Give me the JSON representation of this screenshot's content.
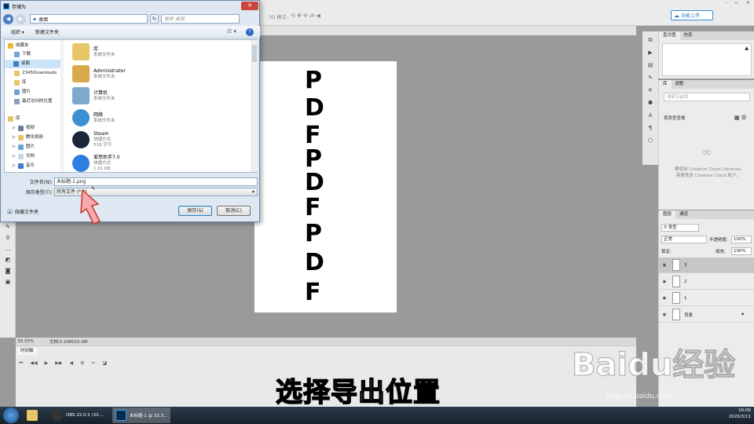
{
  "photoshop": {
    "options_3d_label": "3D 模式:",
    "upload_button": "功能上传",
    "status": {
      "zoom": "33.33%",
      "doc_size": "文档:5.93M/15.0M"
    },
    "timeline_tab": "时间轴",
    "document_letters": [
      "P",
      "D",
      "F",
      "P",
      "D",
      "F",
      "P",
      "D",
      "F"
    ],
    "panels": {
      "top_tabs": [
        "直方图",
        "信息"
      ],
      "library_tabs": [
        "库",
        "调整"
      ],
      "library_search_placeholder": "搜索当前库",
      "library_filter": "按类型查看",
      "library_message_line1": "要使用 Creative Cloud Libraries,",
      "library_message_line2": "需要登录 Creative Cloud 帐户。",
      "layers_tabs": [
        "图层",
        "通道"
      ],
      "layer_kind": "类型",
      "blend_mode": "正常",
      "opacity_label": "不透明度:",
      "opacity_value": "100%",
      "lock_label": "锁定:",
      "fill_label": "填充:",
      "fill_value": "100%",
      "layers": [
        {
          "name": "3",
          "selected": true
        },
        {
          "name": "2",
          "selected": false
        },
        {
          "name": "1",
          "selected": false
        },
        {
          "name": "背景",
          "selected": false
        }
      ]
    }
  },
  "dialog": {
    "title": "存储为",
    "address": "桌面",
    "search_placeholder": "搜索 桌面",
    "organize": "组织 ▾",
    "new_folder": "新建文件夹",
    "nav": [
      {
        "label": "收藏夹",
        "color": "#e8b93a"
      },
      {
        "label": "下载",
        "color": "#6fa3d6"
      },
      {
        "label": "桌面",
        "color": "#3b7dc8"
      },
      {
        "label": "2345Downloads",
        "color": "#e8c567"
      },
      {
        "label": "库",
        "color": "#e8c567"
      },
      {
        "label": "图片",
        "color": "#6fa3d6"
      },
      {
        "label": "最近访问的位置",
        "color": "#8aa0b8"
      },
      {
        "label": "库",
        "color": "#e8c567"
      },
      {
        "label": "视频",
        "color": "#6a7fa0"
      },
      {
        "label": "腾讯视频",
        "color": "#e8c567"
      },
      {
        "label": "图片",
        "color": "#6fa3d6"
      },
      {
        "label": "文档",
        "color": "#c9d6e4"
      },
      {
        "label": "音乐",
        "color": "#3b7dc8"
      }
    ],
    "files": [
      {
        "name": "库",
        "sub": "系统文件夹",
        "color": "#e8c567"
      },
      {
        "name": "Administrator",
        "sub": "系统文件夹",
        "color": "#d8a84a"
      },
      {
        "name": "计算机",
        "sub": "系统文件夹",
        "color": "#7fa8cf"
      },
      {
        "name": "网络",
        "sub": "系统文件夹",
        "color": "#3c8fd0"
      },
      {
        "name": "Steam",
        "sub": "快捷方式",
        "sub2": "518 字节",
        "color": "#1b2838"
      },
      {
        "name": "爱思助手7.0",
        "sub": "快捷方式",
        "sub2": "1.01 KB",
        "color": "#2e7de0"
      }
    ],
    "filename_label": "文件名(N):",
    "filename_value": "未标题-1.png",
    "filetype_label": "保存类型(T):",
    "filetype_value": "所有文件 (*.*)",
    "hide_folders": "隐藏文件夹",
    "save_button": "保存(S)",
    "cancel_button": "取消(C)"
  },
  "subtitle": "选择导出位置",
  "watermark": {
    "logo": "Baidu经验",
    "url": "jingyan.baidu.com"
  },
  "taskbar": {
    "items": [
      "OBS 22.0.2 (32-...",
      "未标题-1 @ 33.3..."
    ],
    "time": "16:06",
    "date": "2020/3/11"
  },
  "colors": {
    "accent": "#2a7bd0",
    "arrow_fill": "#f7a9ad",
    "close_red": "#c9473d"
  }
}
